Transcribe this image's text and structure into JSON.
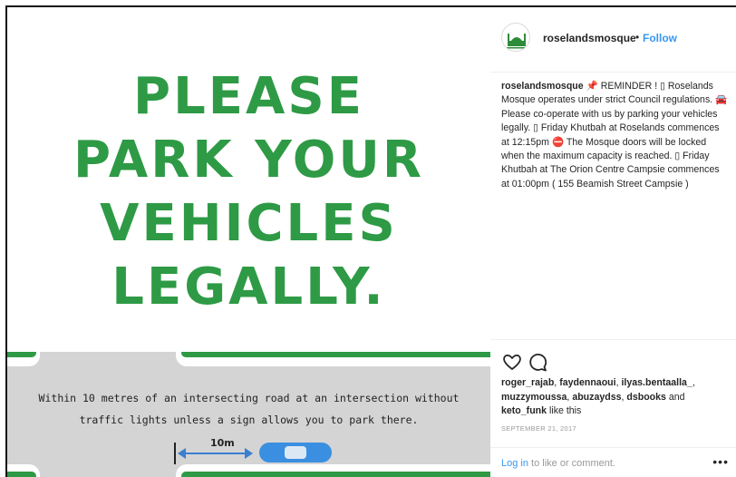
{
  "post_image": {
    "headline_lines": [
      "PLEASE",
      "PARK YOUR",
      "VEHICLES",
      "LEGALLY."
    ],
    "road_text_line1": "Within 10 metres of an intersecting road at an intersection without",
    "road_text_line2": "traffic lights unless a sign allows you to park there.",
    "distance_label": "10m",
    "colors": {
      "headline": "#2e9a45",
      "road": "#d4d4d4",
      "car": "#3a8fe0"
    }
  },
  "header": {
    "username": "roselandsmosque",
    "separator": "•",
    "follow_label": "Follow"
  },
  "caption": {
    "username": "roselandsmosque",
    "text": "📌 REMINDER ! ▯ Roselands Mosque operates under strict Council regulations. 🚘 Please co-operate with us by parking your vehicles legally. ▯ Friday Khutbah at Roselands commences at 12:15pm ⛔ The Mosque doors will be locked when the maximum capacity is reached. ▯ Friday Khutbah at The Orion Centre Campsie commences at 01:00pm ( 155 Beamish Street Campsie )"
  },
  "actions": {
    "like_icon": "heart-icon",
    "comment_icon": "comment-icon"
  },
  "likes": {
    "users": [
      "roger_rajab",
      "faydennaoui",
      "ilyas.bentaalla_",
      "muzzymoussa",
      "abuzaydss",
      "dsbooks"
    ],
    "last_user": "keto_funk",
    "separator": ", ",
    "and_text": " and ",
    "suffix": " like this"
  },
  "date": "SEPTEMBER 21, 2017",
  "comment": {
    "login_link": "Log in",
    "login_rest": " to like or comment.",
    "more_label": "•••"
  }
}
